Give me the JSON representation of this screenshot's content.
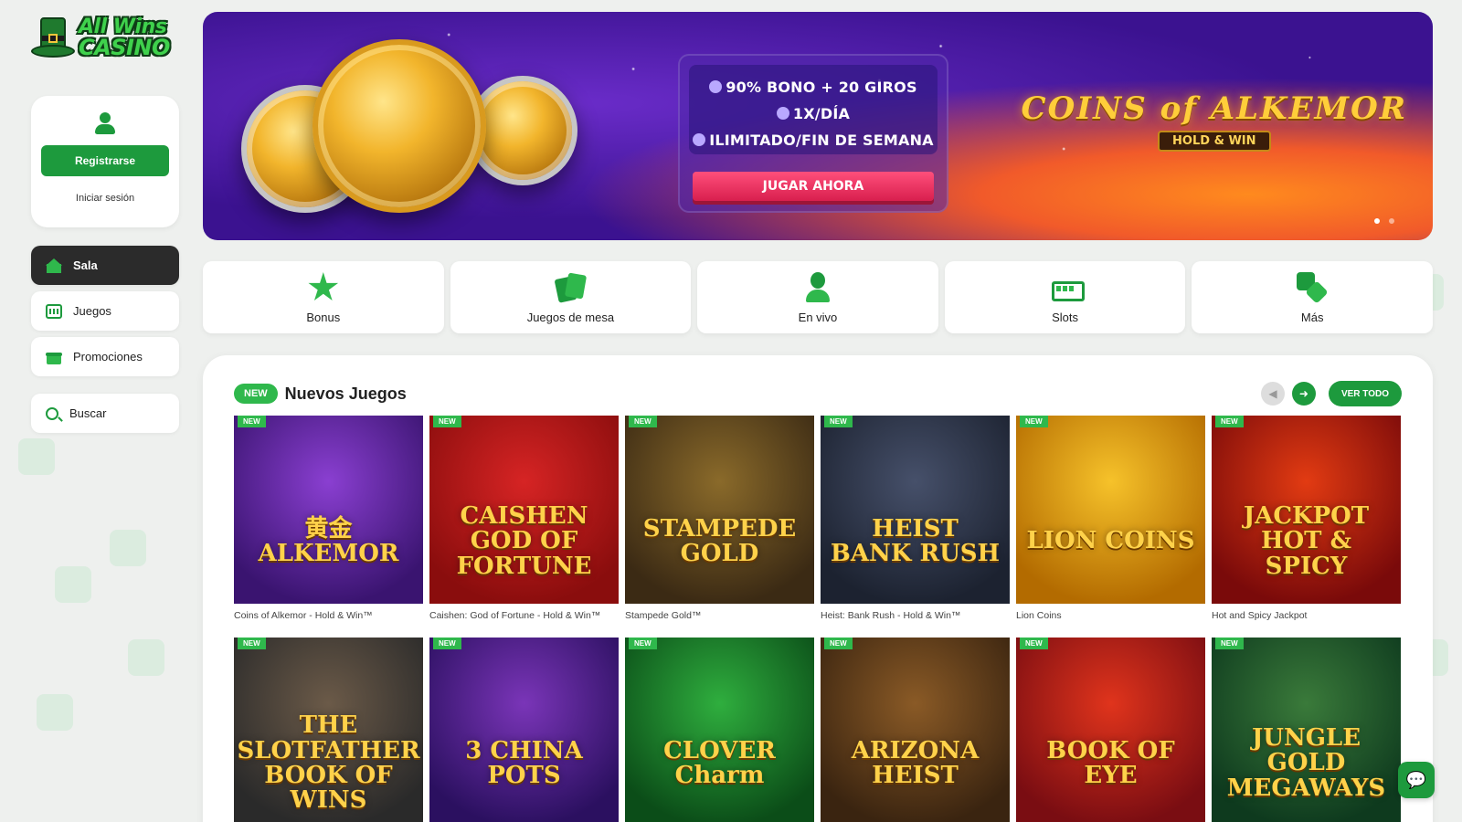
{
  "brand": {
    "line1": "All Wins",
    "line2": "CASINO"
  },
  "account": {
    "register_label": "Registrarse",
    "login_label": "Iniciar sesión"
  },
  "nav": {
    "items": [
      {
        "label": "Sala",
        "icon": "home-icon",
        "active": true
      },
      {
        "label": "Juegos",
        "icon": "slot-machine-icon",
        "active": false
      },
      {
        "label": "Promociones",
        "icon": "gift-icon",
        "active": false
      }
    ],
    "search_label": "Buscar"
  },
  "banner": {
    "promo_lines": [
      "90% BONO + 20 GIROS",
      "1X/DÍA",
      "ILIMITADO/FIN DE SEMANA"
    ],
    "cta_label": "JUGAR AHORA",
    "game_title": "COINS of ALKEMOR",
    "game_subtitle": "HOLD & WIN",
    "slides": 2,
    "active_slide": 1
  },
  "categories": [
    {
      "label": "Bonus",
      "icon": "star-icon"
    },
    {
      "label": "Juegos de mesa",
      "icon": "cards-icon"
    },
    {
      "label": "En vivo",
      "icon": "dealer-icon"
    },
    {
      "label": "Slots",
      "icon": "slot-machine-icon"
    },
    {
      "label": "Más",
      "icon": "dice-icon"
    }
  ],
  "new_games": {
    "pill": "NEW",
    "title": "Nuevos Juegos",
    "see_all_label": "VER TODO",
    "items": [
      {
        "name": "Coins of Alkemor - Hold & Win™",
        "badge": "NEW",
        "art": "黄金 ALKEMOR",
        "colors": [
          "#3a1470",
          "#8a3fd1"
        ]
      },
      {
        "name": "Caishen: God of Fortune - Hold & Win™",
        "badge": "NEW",
        "art": "CAISHEN GOD OF FORTUNE",
        "colors": [
          "#8a0d0d",
          "#d62424"
        ]
      },
      {
        "name": "Stampede Gold™",
        "badge": "NEW",
        "art": "STAMPEDE GOLD",
        "colors": [
          "#3b2a14",
          "#8a6a2a"
        ]
      },
      {
        "name": "Heist: Bank Rush - Hold & Win™",
        "badge": "NEW",
        "art": "HEIST BANK RUSH",
        "colors": [
          "#1c2230",
          "#46506a"
        ]
      },
      {
        "name": "Lion Coins",
        "badge": "NEW",
        "art": "LION COINS",
        "colors": [
          "#b36b00",
          "#f6c22a"
        ]
      },
      {
        "name": "Hot and Spicy Jackpot",
        "badge": "NEW",
        "art": "JACKPOT HOT & SPICY",
        "colors": [
          "#7a0a0a",
          "#e23b12"
        ]
      },
      {
        "name": "",
        "badge": "NEW",
        "art": "THE SLOTFATHER BOOK OF WINS",
        "colors": [
          "#2a2a2a",
          "#6b5a48"
        ]
      },
      {
        "name": "",
        "badge": "NEW",
        "art": "3 CHINA POTS",
        "colors": [
          "#2b1060",
          "#7a35b8"
        ]
      },
      {
        "name": "",
        "badge": "NEW",
        "art": "CLOVER Charm",
        "colors": [
          "#0b4d18",
          "#2fae3e"
        ]
      },
      {
        "name": "",
        "badge": "NEW",
        "art": "ARIZONA HEIST",
        "colors": [
          "#3a2410",
          "#8a5a26"
        ]
      },
      {
        "name": "",
        "badge": "NEW",
        "art": "BOOK OF EYE",
        "colors": [
          "#7a0d12",
          "#e0341c"
        ]
      },
      {
        "name": "",
        "badge": "NEW",
        "art": "JUNGLE GOLD MEGAWAYS",
        "colors": [
          "#0e3a1e",
          "#3a7a3a"
        ]
      }
    ]
  },
  "chat": {
    "icon": "chat-icon"
  }
}
